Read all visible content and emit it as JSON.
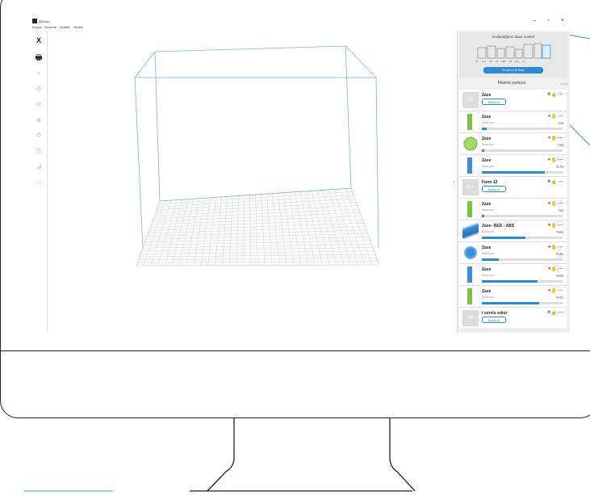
{
  "app": {
    "title": "IDeaIcu",
    "menu": [
      "Dosya",
      "Duzenle",
      "Ayarlar",
      "Yardim"
    ],
    "window_controls": [
      "–",
      "▫",
      "×"
    ]
  },
  "toolbar": {
    "items": [
      {
        "icon": "close-x-icon",
        "glyph": "X"
      },
      {
        "icon": "printer-icon",
        "glyph": "🖶"
      },
      {
        "icon": "add-icon",
        "glyph": "+"
      },
      {
        "icon": "move-icon",
        "glyph": "✥"
      },
      {
        "icon": "move-cross-icon",
        "glyph": "✥"
      },
      {
        "icon": "drop-icon",
        "glyph": "◉"
      },
      {
        "icon": "snap-icon",
        "glyph": "✥"
      },
      {
        "icon": "layers-icon",
        "glyph": "▥"
      },
      {
        "icon": "chart-icon",
        "glyph": "◢"
      },
      {
        "icon": "slope-icon",
        "glyph": "◿"
      }
    ]
  },
  "right_panel": {
    "promo": {
      "title": "Kullandığınız Zaxe modeli",
      "models": [
        "X1",
        "X1+",
        "X2",
        "X3",
        "xlite",
        "Z1",
        "Z1+",
        "Z3"
      ],
      "button": "Bu yazıcı ile ilerle",
      "selected": "Z3"
    },
    "header": "Makine parkuru",
    "collapse_label": "Gizle",
    "machines": [
      {
        "name": "Zaxe",
        "state": "idle",
        "badge": "Z3",
        "action": "Baskı al"
      },
      {
        "name": "Zaxe",
        "state": "printing",
        "status": "Baskıyor...",
        "progress": 6,
        "pct": "%6",
        "thumb": "green-bar"
      },
      {
        "name": "Zaxe",
        "state": "printing",
        "status": "Baskıyor...",
        "progress": 0,
        "pct": "%0",
        "thumb": "green-vase"
      },
      {
        "name": "Zaxe",
        "state": "printing",
        "status": "Baskıyor...",
        "progress": 78,
        "pct": "%78",
        "thumb": "blue-bar"
      },
      {
        "name": "Form 12",
        "state": "idle",
        "badge": "Z1+",
        "action": "Baskı al"
      },
      {
        "name": "Zaxe",
        "state": "printing",
        "status": "Baskıyor...",
        "progress": 1,
        "pct": "%1",
        "thumb": "green-bar"
      },
      {
        "name": "Zaxe- R&D - ABS",
        "state": "printing",
        "status": "Baskıyor...",
        "progress": 54,
        "pct": "%54",
        "thumb": "blue-plate"
      },
      {
        "name": "Zaxe",
        "state": "printing",
        "status": "Baskıyor...",
        "progress": 21,
        "pct": "%21",
        "thumb": "blue-parts"
      },
      {
        "name": "Zaxe",
        "state": "printing",
        "status": "Baskıyor...",
        "progress": 69,
        "pct": "%69",
        "thumb": "blue-bar"
      },
      {
        "name": "Zaxe",
        "state": "printing",
        "status": "Baskıyor...",
        "progress": 71,
        "pct": "%71",
        "thumb": "green-bar"
      },
      {
        "name": "t servis erkur",
        "state": "idle",
        "badge": "Z3",
        "action": "Baskı al"
      }
    ]
  },
  "colors": {
    "accent": "#2a8ad8",
    "build_volume": "#7fb3e0",
    "grid": "#c8c8c8"
  }
}
